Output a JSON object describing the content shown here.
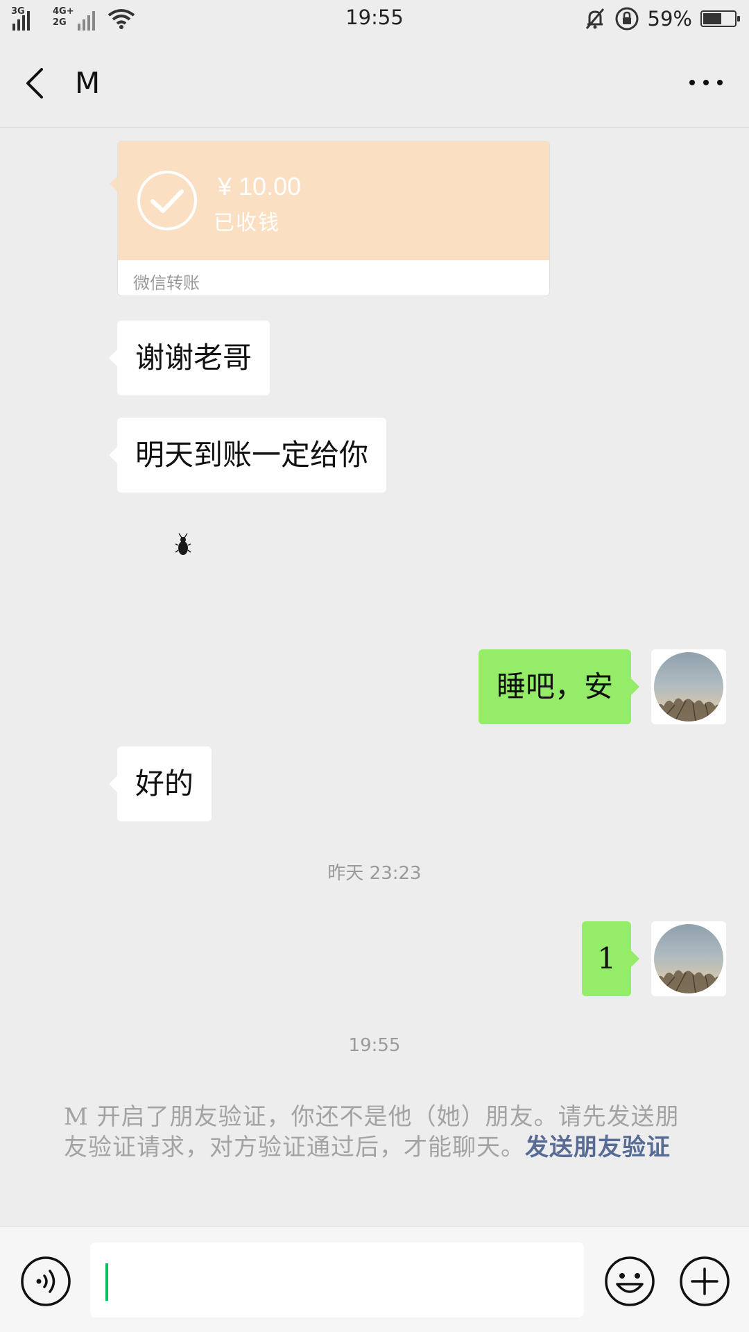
{
  "status_bar": {
    "network_primary": "3G",
    "network_secondary_top": "4G+",
    "network_secondary_bottom": "2G",
    "time": "19:55",
    "battery_percent": "59%",
    "battery_level": 0.59,
    "icons": [
      "signal-icon",
      "wifi-icon",
      "mute-icon",
      "rotation-lock-icon",
      "battery-icon"
    ]
  },
  "nav": {
    "title": "M",
    "back_icon": "chevron-left-icon",
    "more_icon": "more-icon"
  },
  "messages": {
    "transfer": {
      "amount": "¥ 10.00",
      "status": "已收钱",
      "footer": "微信转账"
    },
    "m1": "谢谢老哥",
    "m2": "明天到账一定给你",
    "m3": "睡吧，安",
    "m4": "好的",
    "ts1": "昨天 23:23",
    "m5": "1",
    "ts2": "19:55"
  },
  "notice": {
    "text": "M 开启了朋友验证，你还不是他（她）朋友。请先发送朋友验证请求，对方验证通过后，才能聊天。",
    "link": "发送朋友验证"
  },
  "input_bar": {
    "value": "",
    "icons": [
      "voice-icon",
      "emoji-icon",
      "plus-icon"
    ]
  },
  "colors": {
    "background": "#ededed",
    "outgoing_bubble": "#95ec69",
    "incoming_bubble": "#ffffff",
    "transfer_card": "#fbdfc2",
    "link": "#576b95",
    "caret": "#07c160"
  }
}
